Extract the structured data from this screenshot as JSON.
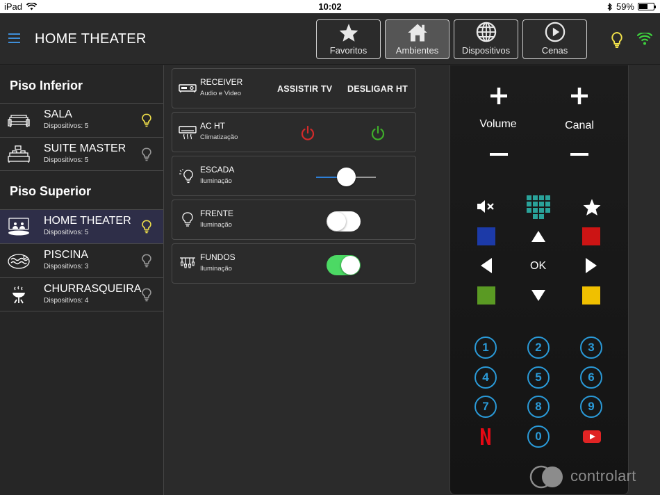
{
  "status_bar": {
    "device": "iPad",
    "time": "10:02",
    "battery": "59%",
    "battery_level": 0.59
  },
  "header": {
    "title": "HOME THEATER",
    "nav": [
      {
        "label": "Favoritos",
        "icon": "star-icon",
        "active": false
      },
      {
        "label": "Ambientes",
        "icon": "home-icon",
        "active": true
      },
      {
        "label": "Dispositivos",
        "icon": "globe-icon",
        "active": false
      },
      {
        "label": "Cenas",
        "icon": "play-circle-icon",
        "active": false
      }
    ],
    "colors": {
      "bulb": "#f2e24a",
      "wifi": "#3ed13e",
      "menu": "#3f8fd9"
    }
  },
  "sidebar": {
    "sections": [
      {
        "title": "Piso Inferior",
        "rooms": [
          {
            "name": "SALA",
            "count": "Dispositivos: 5",
            "icon": "sofa-icon",
            "bulb_on": true
          },
          {
            "name": "SUITE MASTER",
            "count": "Dispositivos: 5",
            "icon": "bed-icon",
            "bulb_on": false
          }
        ]
      },
      {
        "title": "Piso Superior",
        "rooms": [
          {
            "name": "HOME THEATER",
            "count": "Dispositivos: 5",
            "icon": "cinema-icon",
            "bulb_on": true,
            "active": true
          },
          {
            "name": "PISCINA",
            "count": "Dispositivos: 3",
            "icon": "pool-icon",
            "bulb_on": false
          },
          {
            "name": "CHURRASQUEIRA",
            "count": "Dispositivos: 4",
            "icon": "grill-icon",
            "bulb_on": false
          }
        ]
      }
    ]
  },
  "devices": [
    {
      "name": "RECEIVER",
      "subtitle": "Audio e Video",
      "icon": "receiver-icon",
      "actions": [
        "ASSISTIR TV",
        "DESLIGAR HT"
      ]
    },
    {
      "name": "AC HT",
      "subtitle": "Climatização",
      "icon": "air-conditioner-icon",
      "power_off_color": "#d42a2a",
      "power_on_color": "#3fae2a"
    },
    {
      "name": "ESCADA",
      "subtitle": "Iluminação",
      "icon": "dimmer-bulb-icon",
      "level": 0.5
    },
    {
      "name": "FRENTE",
      "subtitle": "Iluminação",
      "icon": "bulb-icon",
      "on": false
    },
    {
      "name": "FUNDOS",
      "subtitle": "Iluminação",
      "icon": "chandelier-icon",
      "on": true
    }
  ],
  "remote": {
    "volume_label": "Volume",
    "channel_label": "Canal",
    "ok_label": "OK",
    "numbers": [
      "1",
      "2",
      "3",
      "4",
      "5",
      "6",
      "7",
      "8",
      "9",
      "0"
    ],
    "colors": {
      "blue": "#1c3aa8",
      "red": "#cc1414",
      "green": "#5a9a23",
      "yellow": "#f0c000",
      "number": "#2a9ad8",
      "keypad": "#2aa39a",
      "netflix": "#e50914",
      "youtube": "#e02424"
    },
    "brand": "controlart"
  }
}
